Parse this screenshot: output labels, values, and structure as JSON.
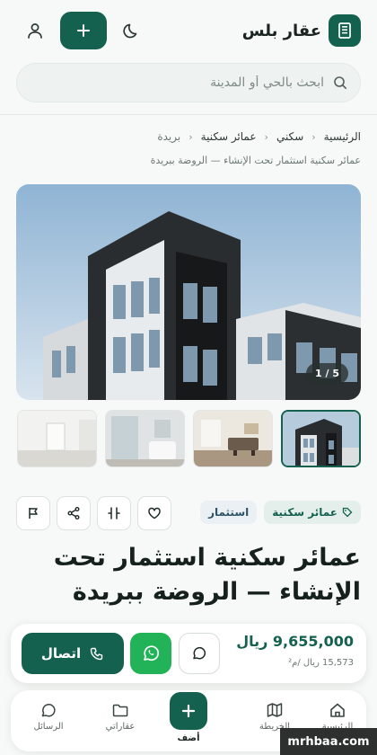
{
  "app": {
    "name": "عقار بلس"
  },
  "search": {
    "placeholder": "ابحث بالحي أو المدينة"
  },
  "breadcrumb": {
    "items": [
      "الرئيسية",
      "سكني",
      "عمائر سكنية",
      "بريدة"
    ],
    "sub": "عمائر سكنية استثمار تحت الإنشاء — الروضة ببريدة"
  },
  "gallery": {
    "counter": "1 / 5",
    "total": 5,
    "current": 1
  },
  "tags": {
    "primary": "عمائر سكنية",
    "secondary": "استثمار"
  },
  "listing": {
    "title": "عمائر سكنية استثمار تحت الإنشاء — الروضة ببريدة",
    "price": "9,655,000 ريال",
    "per_meter": "15,573 ريال /م²"
  },
  "contact": {
    "call_label": "اتصال"
  },
  "nav": {
    "home": "الرئيسية",
    "map": "الخريطة",
    "add": "أضف",
    "my_properties": "عقاراتي",
    "messages": "الرسائل"
  },
  "watermark": "mrhbaa.com",
  "colors": {
    "brand": "#15614f",
    "whatsapp": "#22b257",
    "background": "#f7f9f8"
  }
}
